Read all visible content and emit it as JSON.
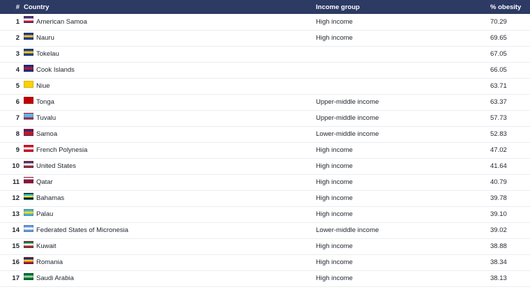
{
  "header": {
    "rank": "#",
    "country": "Country",
    "income": "Income group",
    "obesity": "% obesity"
  },
  "rows": [
    {
      "rank": "1",
      "country": "American Samoa",
      "income": "High income",
      "obesity": "70.29",
      "flag_icon": "american-samoa-flag-icon",
      "flag_colors": [
        "#1e3f8c",
        "#ffffff",
        "#c8102e"
      ]
    },
    {
      "rank": "2",
      "country": "Nauru",
      "income": "High income",
      "obesity": "69.65",
      "flag_icon": "nauru-flag-icon",
      "flag_colors": [
        "#1d3c8f",
        "#ffc61e",
        "#1d3c8f"
      ]
    },
    {
      "rank": "3",
      "country": "Tokelau",
      "income": "",
      "obesity": "67.05",
      "flag_icon": "tokelau-flag-icon",
      "flag_colors": [
        "#1e3f8c",
        "#ffcc00",
        "#1e3f8c"
      ]
    },
    {
      "rank": "4",
      "country": "Cook Islands",
      "income": "",
      "obesity": "66.05",
      "flag_icon": "cook-islands-flag-icon",
      "flag_colors": [
        "#1c2f7a",
        "#c8102e",
        "#1c2f7a"
      ]
    },
    {
      "rank": "5",
      "country": "Niue",
      "income": "",
      "obesity": "63.71",
      "flag_icon": "niue-flag-icon",
      "flag_colors": [
        "#fed100",
        "#fed100",
        "#fed100"
      ]
    },
    {
      "rank": "6",
      "country": "Tonga",
      "income": "Upper-middle income",
      "obesity": "63.37",
      "flag_icon": "tonga-flag-icon",
      "flag_colors": [
        "#c10000",
        "#c10000",
        "#c10000"
      ]
    },
    {
      "rank": "7",
      "country": "Tuvalu",
      "income": "Upper-middle income",
      "obesity": "57.73",
      "flag_icon": "tuvalu-flag-icon",
      "flag_colors": [
        "#5bb7e8",
        "#5bb7e8",
        "#c8102e"
      ]
    },
    {
      "rank": "8",
      "country": "Samoa",
      "income": "Lower-middle income",
      "obesity": "52.83",
      "flag_icon": "samoa-flag-icon",
      "flag_colors": [
        "#1c2f7a",
        "#ce1126",
        "#ce1126"
      ]
    },
    {
      "rank": "9",
      "country": "French Polynesia",
      "income": "High income",
      "obesity": "47.02",
      "flag_icon": "french-polynesia-flag-icon",
      "flag_colors": [
        "#ce1126",
        "#ffffff",
        "#ce1126"
      ]
    },
    {
      "rank": "10",
      "country": "United States",
      "income": "High income",
      "obesity": "41.64",
      "flag_icon": "united-states-flag-icon",
      "flag_colors": [
        "#3c3b6e",
        "#ffffff",
        "#b22234"
      ]
    },
    {
      "rank": "11",
      "country": "Qatar",
      "income": "High income",
      "obesity": "40.79",
      "flag_icon": "qatar-flag-icon",
      "flag_colors": [
        "#ffffff",
        "#8a1538",
        "#8a1538"
      ]
    },
    {
      "rank": "12",
      "country": "Bahamas",
      "income": "High income",
      "obesity": "39.78",
      "flag_icon": "bahamas-flag-icon",
      "flag_colors": [
        "#00abc9",
        "#fae042",
        "#000000"
      ]
    },
    {
      "rank": "13",
      "country": "Palau",
      "income": "High income",
      "obesity": "39.10",
      "flag_icon": "palau-flag-icon",
      "flag_colors": [
        "#4aadd6",
        "#ffde00",
        "#4aadd6"
      ]
    },
    {
      "rank": "14",
      "country": "Federated States of Micronesia",
      "income": "Lower-middle income",
      "obesity": "39.02",
      "flag_icon": "micronesia-flag-icon",
      "flag_colors": [
        "#6797d6",
        "#ffffff",
        "#6797d6"
      ]
    },
    {
      "rank": "15",
      "country": "Kuwait",
      "income": "High income",
      "obesity": "38.88",
      "flag_icon": "kuwait-flag-icon",
      "flag_colors": [
        "#007a3d",
        "#ffffff",
        "#ce1126"
      ]
    },
    {
      "rank": "16",
      "country": "Romania",
      "income": "High income",
      "obesity": "38.34",
      "flag_icon": "romania-flag-icon",
      "flag_colors": [
        "#002b7f",
        "#fcd116",
        "#ce1126"
      ]
    },
    {
      "rank": "17",
      "country": "Saudi Arabia",
      "income": "High income",
      "obesity": "38.13",
      "flag_icon": "saudi-arabia-flag-icon",
      "flag_colors": [
        "#006c35",
        "#9fd3a0",
        "#006c35"
      ]
    }
  ]
}
